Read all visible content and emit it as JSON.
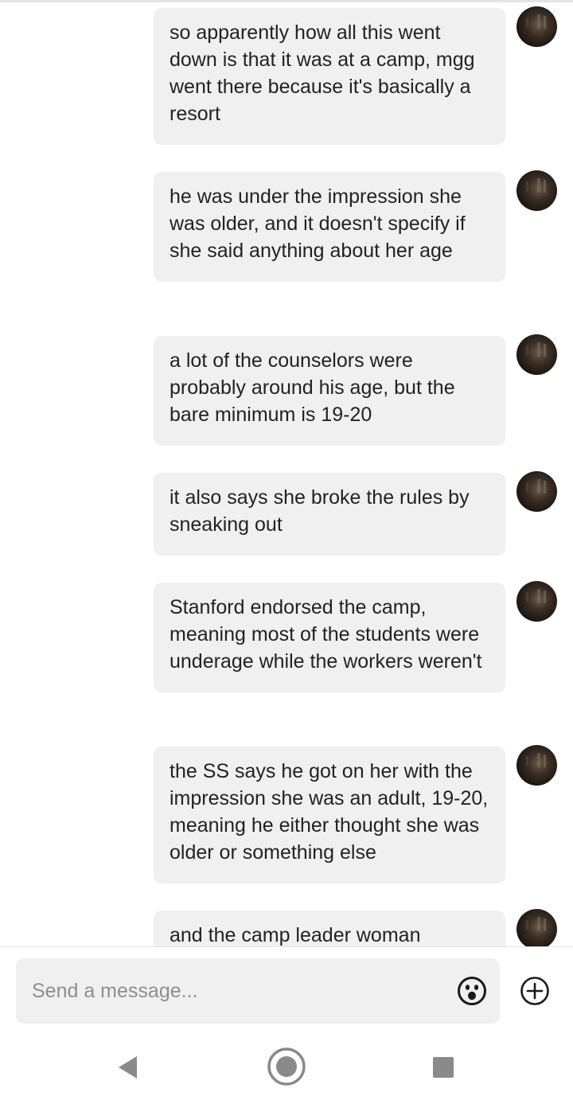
{
  "messages": [
    {
      "text": "so apparently how all this went down is that it was at a camp, mgg went there because it's basically a resort",
      "avatar_icon": "user-avatar"
    },
    {
      "text": "he was under the impression she was older, and it doesn't specify if she said anything about her age",
      "avatar_icon": "user-avatar"
    },
    {
      "text": "a lot of the counselors were probably around his age, but the bare minimum is 19-20",
      "avatar_icon": "user-avatar"
    },
    {
      "text": "it also says she broke the rules by sneaking out",
      "avatar_icon": "user-avatar"
    },
    {
      "text": "Stanford endorsed the camp, meaning most of the students were underage while the workers weren't",
      "avatar_icon": "user-avatar"
    },
    {
      "text": "the SS says he got on her with the impression she was an adult, 19-20, meaning he either thought she was older or something else",
      "avatar_icon": "user-avatar"
    },
    {
      "text": "and the camp leader woman",
      "avatar_icon": "user-avatar"
    }
  ],
  "composer": {
    "placeholder": "Send a message...",
    "value": "",
    "emoji_icon": "emoji-icon",
    "add_icon": "plus-circle-icon"
  },
  "navbar": {
    "back_icon": "back-triangle-icon",
    "home_icon": "home-circle-icon",
    "recents_icon": "recents-square-icon"
  },
  "colors": {
    "bubble": "#f0f0f0",
    "text": "#222222",
    "placeholder": "#8e8e8e",
    "nav": "#8a8a8a"
  }
}
